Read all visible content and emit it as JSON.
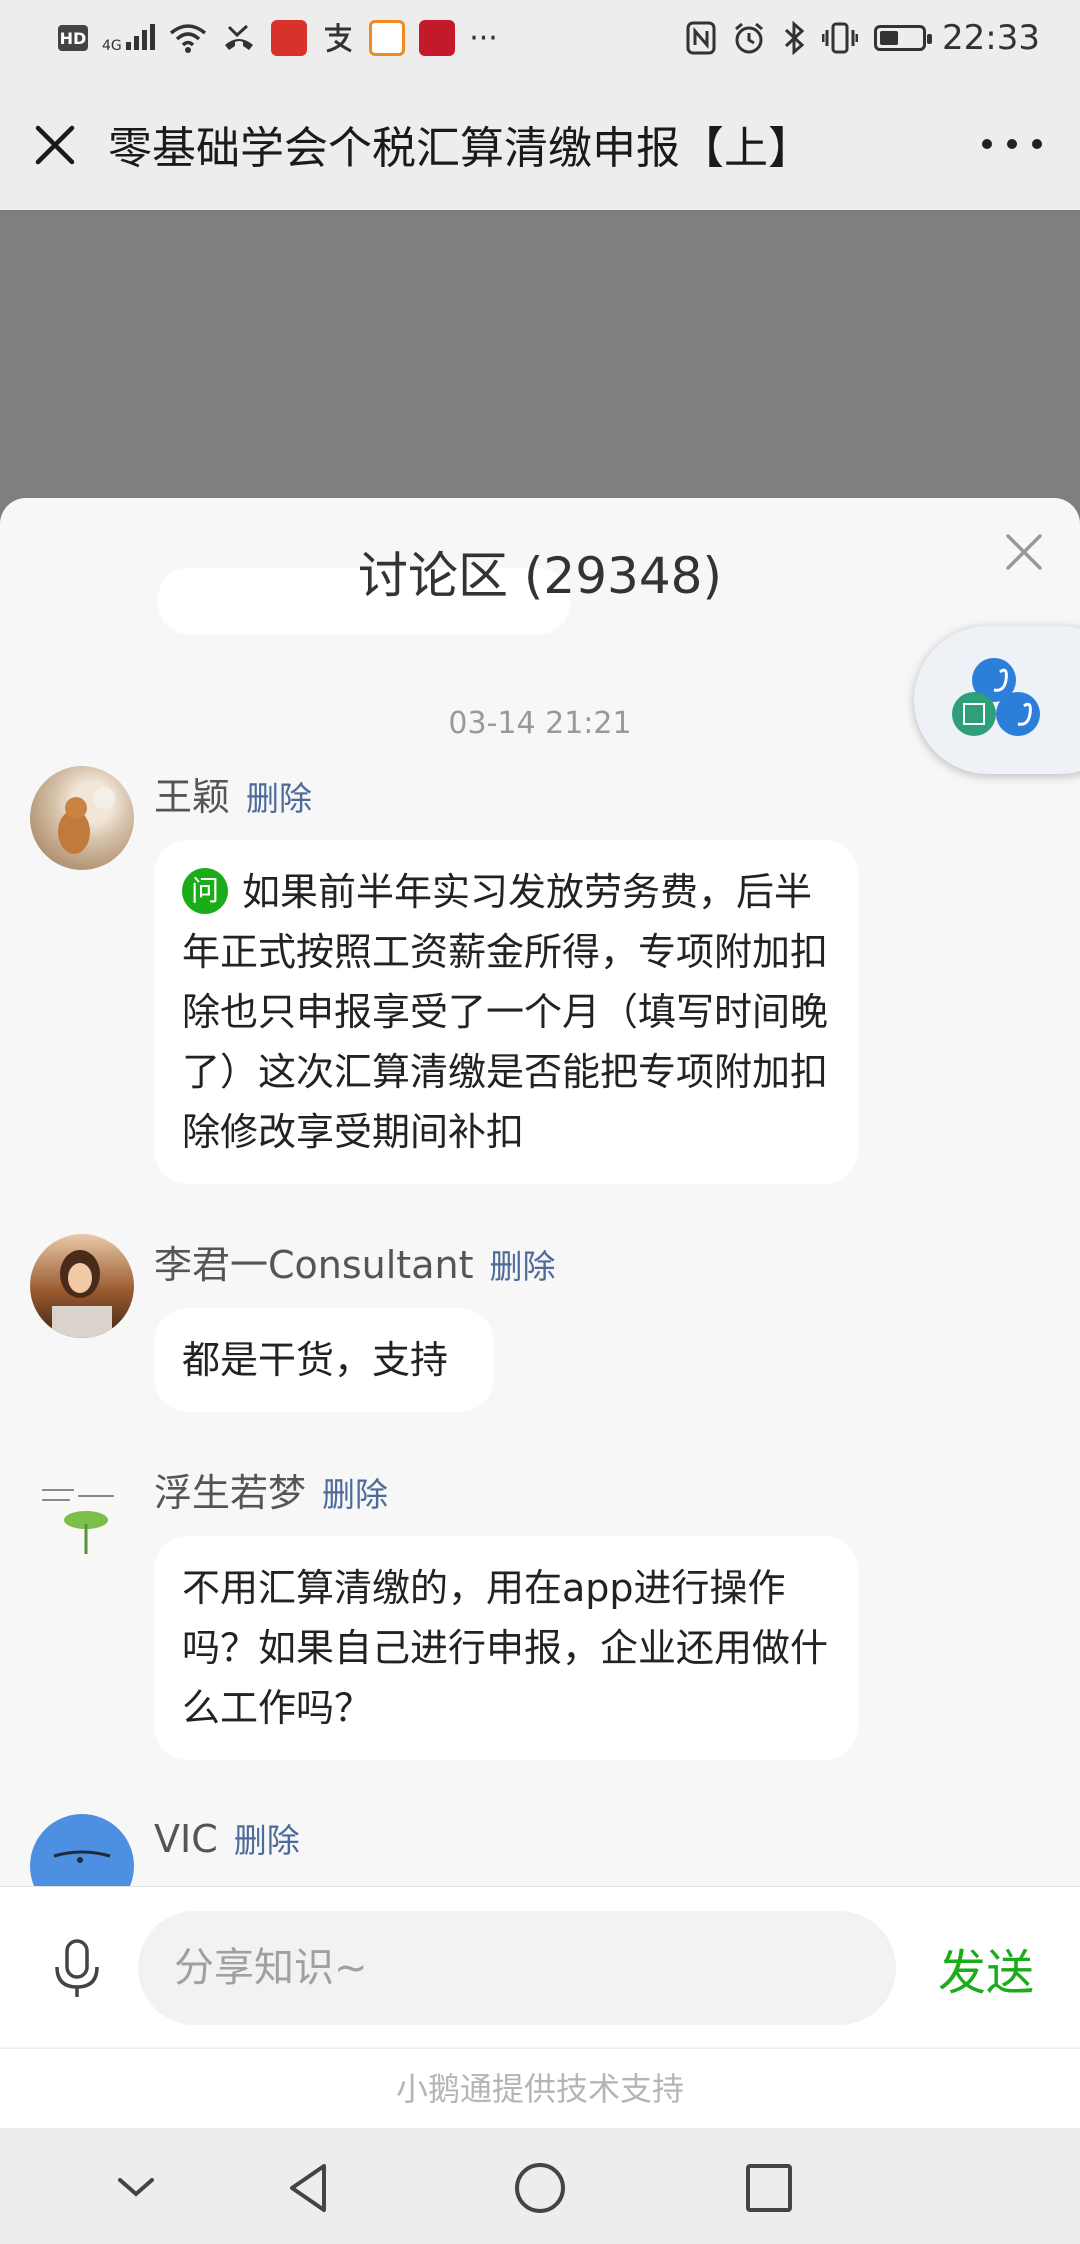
{
  "status_bar": {
    "hd": "HD",
    "network": "4G",
    "more": "···",
    "time": "22:33",
    "battery_level": 0.45
  },
  "title_bar": {
    "title": "零基础学会个税汇算清缴申报【上】"
  },
  "discussion": {
    "title": "讨论区 (29348)",
    "timestamp": "03-14 21:21",
    "delete_label": "删除",
    "question_badge": "问",
    "messages": [
      {
        "author": "王颖",
        "text": "如果前半年实习发放劳务费，后半年正式按照工资薪金所得，专项附加扣除也只申报享受了一个月（填写时间晚了）这次汇算清缴是否能把专项附加扣除修改享受期间补扣",
        "is_question": true
      },
      {
        "author": "李君一Consultant",
        "text": "都是干货，支持",
        "is_question": false
      },
      {
        "author": "浮生若梦",
        "text": "不用汇算清缴的，用在app进行操作吗？如果自己进行申报，企业还用做什么工作吗？",
        "is_question": false
      },
      {
        "author": "VIC",
        "text": "",
        "is_question": false
      }
    ]
  },
  "input_bar": {
    "placeholder": "分享知识~",
    "send_label": "发送"
  },
  "footer": {
    "support_text": "小鹅通提供技术支持"
  },
  "colors": {
    "accent_green": "#1aad19",
    "link_blue": "#4c6a9a",
    "overlay_gray": "#7f7f7f"
  }
}
